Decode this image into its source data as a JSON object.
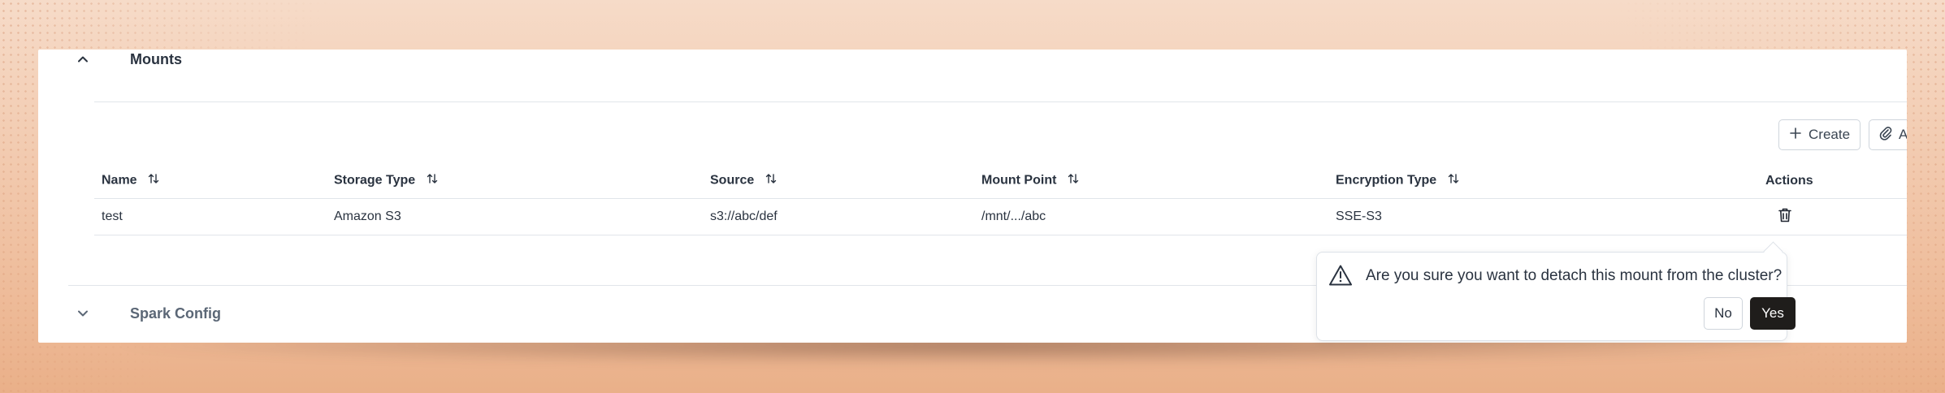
{
  "mounts": {
    "title": "Mounts",
    "toolbar": {
      "create_label": "Create",
      "attach_label": "A"
    },
    "columns": [
      "Name",
      "Storage Type",
      "Source",
      "Mount Point",
      "Encryption Type",
      "Actions"
    ],
    "rows": [
      {
        "name": "test",
        "storage_type": "Amazon S3",
        "source": "s3://abc/def",
        "mount_point": "/mnt/.../abc",
        "encryption_type": "SSE-S3"
      }
    ]
  },
  "spark_config": {
    "title": "Spark Config"
  },
  "popover": {
    "message": "Are you sure you want to detach this mount from the cluster?",
    "no_label": "No",
    "yes_label": "Yes"
  },
  "icons": {
    "collapse": "chevron-up-icon",
    "expand": "chevron-down-icon",
    "create": "plus-icon",
    "attach": "paperclip-icon",
    "sort": "sort-icon",
    "delete": "trash-icon",
    "warning": "warning-triangle-icon"
  },
  "colors": {
    "primary_button": "#1f1d1b",
    "text": "#2a3340",
    "border": "#e1e5ea"
  }
}
